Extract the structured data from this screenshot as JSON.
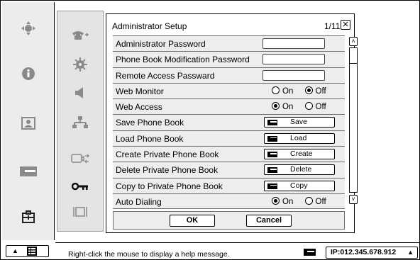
{
  "dialog": {
    "title": "Administrator Setup",
    "page": "1/11",
    "close_glyph": "✕",
    "rows": [
      {
        "label": "Administrator Password",
        "control": "password"
      },
      {
        "label": "Phone Book Modification Password",
        "control": "password"
      },
      {
        "label": "Remote Access Passward",
        "control": "password"
      },
      {
        "label": "Web Monitor",
        "control": "radio",
        "options": [
          "On",
          "Off"
        ],
        "selected": "Off"
      },
      {
        "label": "Web Access",
        "control": "radio",
        "options": [
          "On",
          "Off"
        ],
        "selected": "On"
      },
      {
        "label": "Save Phone Book",
        "control": "button",
        "button_label": "Save"
      },
      {
        "label": "Load Phone Book",
        "control": "button",
        "button_label": "Load"
      },
      {
        "label": "Create Private Phone Book",
        "control": "button",
        "button_label": "Create"
      },
      {
        "label": "Delete Private Phone Book",
        "control": "button",
        "button_label": "Delete"
      },
      {
        "label": "Copy to Private Phone Book",
        "control": "button",
        "button_label": "Copy"
      },
      {
        "label": "Auto Dialing",
        "control": "radio",
        "options": [
          "On",
          "Off"
        ],
        "selected": "On"
      }
    ],
    "ok_label": "OK",
    "cancel_label": "Cancel"
  },
  "scrollbar": {
    "up_glyph": "⌃",
    "down_glyph": "⌄"
  },
  "left_icons": [
    "camera-move-icon",
    "info-icon",
    "contact-card-icon",
    "memory-card-icon",
    "toolbox-icon"
  ],
  "mid_icons": [
    "phone-icon",
    "gear-icon",
    "speaker-icon",
    "network-icon",
    "video-input-icon",
    "key-icon",
    "display-icon"
  ],
  "status": {
    "help_message": "Right-click the mouse to display a help message.",
    "ip_label": "IP:012.345.678.912",
    "ip_arrow": "▲"
  },
  "menu_button": {
    "arrow": "▲"
  },
  "colors": {
    "panel": "#ededed",
    "sidebar": "#ececec",
    "icon_gray": "#8a8a8a",
    "icon_dark": "#222222"
  }
}
